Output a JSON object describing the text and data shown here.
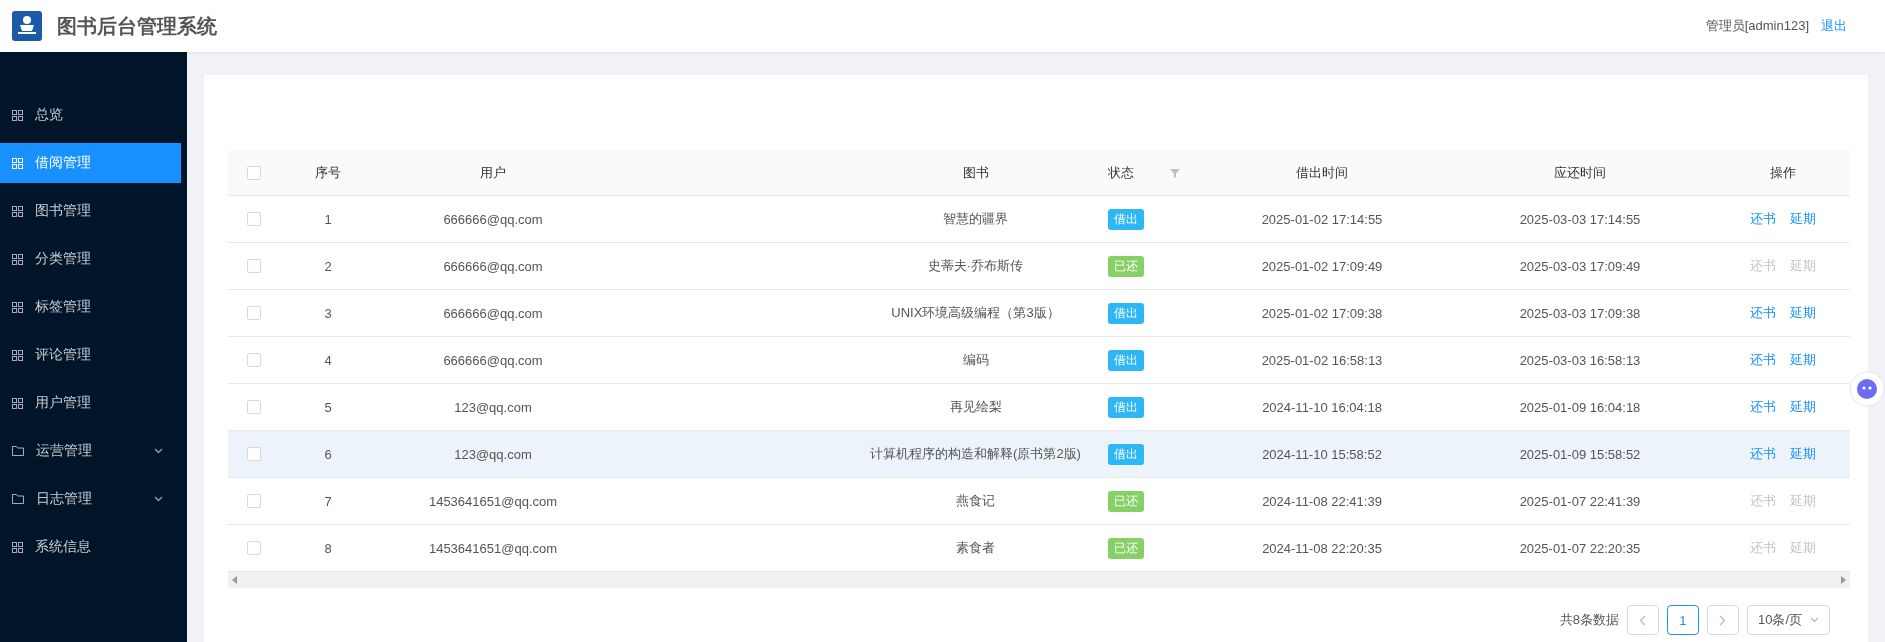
{
  "header": {
    "title": "图书后台管理系统",
    "user": "管理员[admin123]",
    "logout": "退出"
  },
  "sidebar": {
    "items": [
      {
        "label": "总览",
        "kind": "page",
        "selected": false
      },
      {
        "label": "借阅管理",
        "kind": "page",
        "selected": true
      },
      {
        "label": "图书管理",
        "kind": "page",
        "selected": false
      },
      {
        "label": "分类管理",
        "kind": "page",
        "selected": false
      },
      {
        "label": "标签管理",
        "kind": "page",
        "selected": false
      },
      {
        "label": "评论管理",
        "kind": "page",
        "selected": false
      },
      {
        "label": "用户管理",
        "kind": "page",
        "selected": false
      },
      {
        "label": "运营管理",
        "kind": "group",
        "selected": false,
        "expanded": false
      },
      {
        "label": "日志管理",
        "kind": "group",
        "selected": false,
        "expanded": false
      },
      {
        "label": "系统信息",
        "kind": "page",
        "selected": false
      }
    ]
  },
  "table": {
    "select_all": {
      "checked": false
    },
    "columns": [
      "序号",
      "用户",
      "图书",
      "状态",
      "借出时间",
      "应还时间",
      "操作"
    ],
    "rows": [
      {
        "checked": false,
        "highlighted": false,
        "no": "1",
        "user": "666666@qq.com",
        "book": "智慧的疆界",
        "status": {
          "label": "借出",
          "color": "#2db7f5"
        },
        "borrowed": "2025-01-02 17:14:55",
        "due": "2025-03-03 17:14:55",
        "actions": [
          {
            "label": "还书",
            "disabled": false
          },
          {
            "label": "延期",
            "disabled": false
          }
        ]
      },
      {
        "checked": false,
        "highlighted": false,
        "no": "2",
        "user": "666666@qq.com",
        "book": "史蒂夫·乔布斯传",
        "status": {
          "label": "已还",
          "color": "#87d068"
        },
        "borrowed": "2025-01-02 17:09:49",
        "due": "2025-03-03 17:09:49",
        "actions": [
          {
            "label": "还书",
            "disabled": true
          },
          {
            "label": "延期",
            "disabled": true
          }
        ]
      },
      {
        "checked": false,
        "highlighted": false,
        "no": "3",
        "user": "666666@qq.com",
        "book": "UNIX环境高级编程（第3版）",
        "status": {
          "label": "借出",
          "color": "#2db7f5"
        },
        "borrowed": "2025-01-02 17:09:38",
        "due": "2025-03-03 17:09:38",
        "actions": [
          {
            "label": "还书",
            "disabled": false
          },
          {
            "label": "延期",
            "disabled": false
          }
        ]
      },
      {
        "checked": false,
        "highlighted": false,
        "no": "4",
        "user": "666666@qq.com",
        "book": "编码",
        "status": {
          "label": "借出",
          "color": "#2db7f5"
        },
        "borrowed": "2025-01-02 16:58:13",
        "due": "2025-03-03 16:58:13",
        "actions": [
          {
            "label": "还书",
            "disabled": false
          },
          {
            "label": "延期",
            "disabled": false
          }
        ]
      },
      {
        "checked": false,
        "highlighted": false,
        "no": "5",
        "user": "123@qq.com",
        "book": "再见绘梨",
        "status": {
          "label": "借出",
          "color": "#2db7f5"
        },
        "borrowed": "2024-11-10 16:04:18",
        "due": "2025-01-09 16:04:18",
        "actions": [
          {
            "label": "还书",
            "disabled": false
          },
          {
            "label": "延期",
            "disabled": false
          }
        ]
      },
      {
        "checked": false,
        "highlighted": true,
        "no": "6",
        "user": "123@qq.com",
        "book": "计算机程序的构造和解释(原书第2版)",
        "status": {
          "label": "借出",
          "color": "#2db7f5"
        },
        "borrowed": "2024-11-10 15:58:52",
        "due": "2025-01-09 15:58:52",
        "actions": [
          {
            "label": "还书",
            "disabled": false
          },
          {
            "label": "延期",
            "disabled": false
          }
        ]
      },
      {
        "checked": false,
        "highlighted": false,
        "no": "7",
        "user": "1453641651@qq.com",
        "book": "燕食记",
        "status": {
          "label": "已还",
          "color": "#87d068"
        },
        "borrowed": "2024-11-08 22:41:39",
        "due": "2025-01-07 22:41:39",
        "actions": [
          {
            "label": "还书",
            "disabled": true
          },
          {
            "label": "延期",
            "disabled": true
          }
        ]
      },
      {
        "checked": false,
        "highlighted": false,
        "no": "8",
        "user": "1453641651@qq.com",
        "book": "素食者",
        "status": {
          "label": "已还",
          "color": "#87d068"
        },
        "borrowed": "2024-11-08 22:20:35",
        "due": "2025-01-07 22:20:35",
        "actions": [
          {
            "label": "还书",
            "disabled": true
          },
          {
            "label": "延期",
            "disabled": true
          }
        ]
      }
    ]
  },
  "pagination": {
    "total": "共8条数据",
    "pages": [
      {
        "label": "1",
        "selected": true
      }
    ],
    "page_size": "10条/页"
  }
}
